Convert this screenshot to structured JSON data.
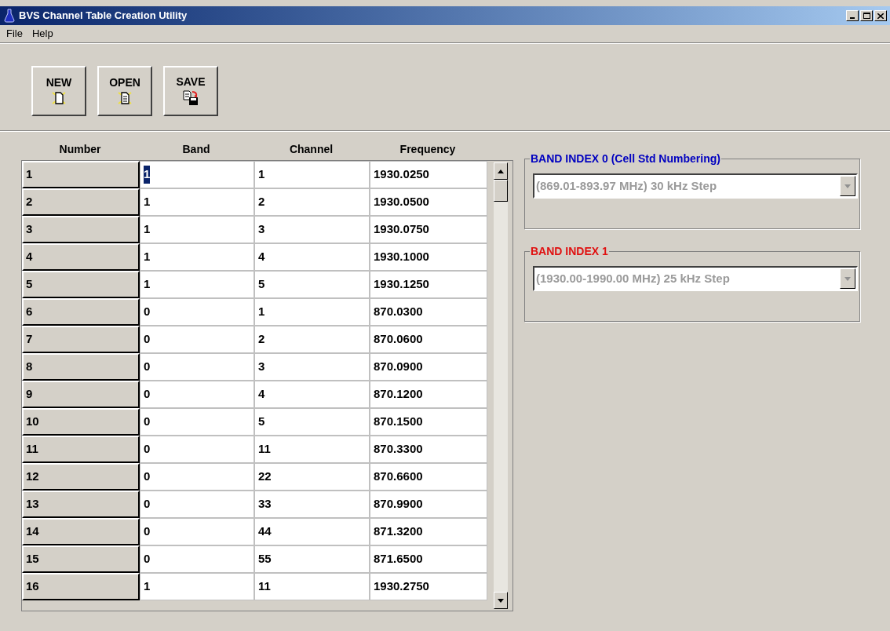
{
  "window": {
    "title": "BVS Channel Table Creation Utility"
  },
  "menu": [
    "File",
    "Help"
  ],
  "toolbar": [
    {
      "label": "NEW",
      "kind": "new"
    },
    {
      "label": "OPEN",
      "kind": "open"
    },
    {
      "label": "SAVE",
      "kind": "save"
    }
  ],
  "table": {
    "columns": [
      "Number",
      "Band",
      "Channel",
      "Frequency"
    ],
    "rows": [
      {
        "number": "1",
        "band": "1",
        "channel": "1",
        "frequency": "1930.0250",
        "selected": true
      },
      {
        "number": "2",
        "band": "1",
        "channel": "2",
        "frequency": "1930.0500",
        "selected": false
      },
      {
        "number": "3",
        "band": "1",
        "channel": "3",
        "frequency": "1930.0750",
        "selected": false
      },
      {
        "number": "4",
        "band": "1",
        "channel": "4",
        "frequency": "1930.1000",
        "selected": false
      },
      {
        "number": "5",
        "band": "1",
        "channel": "5",
        "frequency": "1930.1250",
        "selected": false
      },
      {
        "number": "6",
        "band": "0",
        "channel": "1",
        "frequency": "870.0300",
        "selected": false
      },
      {
        "number": "7",
        "band": "0",
        "channel": "2",
        "frequency": "870.0600",
        "selected": false
      },
      {
        "number": "8",
        "band": "0",
        "channel": "3",
        "frequency": "870.0900",
        "selected": false
      },
      {
        "number": "9",
        "band": "0",
        "channel": "4",
        "frequency": "870.1200",
        "selected": false
      },
      {
        "number": "10",
        "band": "0",
        "channel": "5",
        "frequency": "870.1500",
        "selected": false
      },
      {
        "number": "11",
        "band": "0",
        "channel": "11",
        "frequency": "870.3300",
        "selected": false
      },
      {
        "number": "12",
        "band": "0",
        "channel": "22",
        "frequency": "870.6600",
        "selected": false
      },
      {
        "number": "13",
        "band": "0",
        "channel": "33",
        "frequency": "870.9900",
        "selected": false
      },
      {
        "number": "14",
        "band": "0",
        "channel": "44",
        "frequency": "871.3200",
        "selected": false
      },
      {
        "number": "15",
        "band": "0",
        "channel": "55",
        "frequency": "871.6500",
        "selected": false
      },
      {
        "number": "16",
        "band": "1",
        "channel": "11",
        "frequency": "1930.2750",
        "selected": false
      }
    ]
  },
  "band_groups": [
    {
      "title": "BAND INDEX 0 (Cell Std Numbering)",
      "color": "#0000c0",
      "value": "(869.01-893.97 MHz) 30 kHz Step",
      "disabled": true
    },
    {
      "title": "BAND INDEX 1",
      "color": "#e01010",
      "value": "(1930.00-1990.00 MHz) 25 kHz Step",
      "disabled": true
    }
  ]
}
